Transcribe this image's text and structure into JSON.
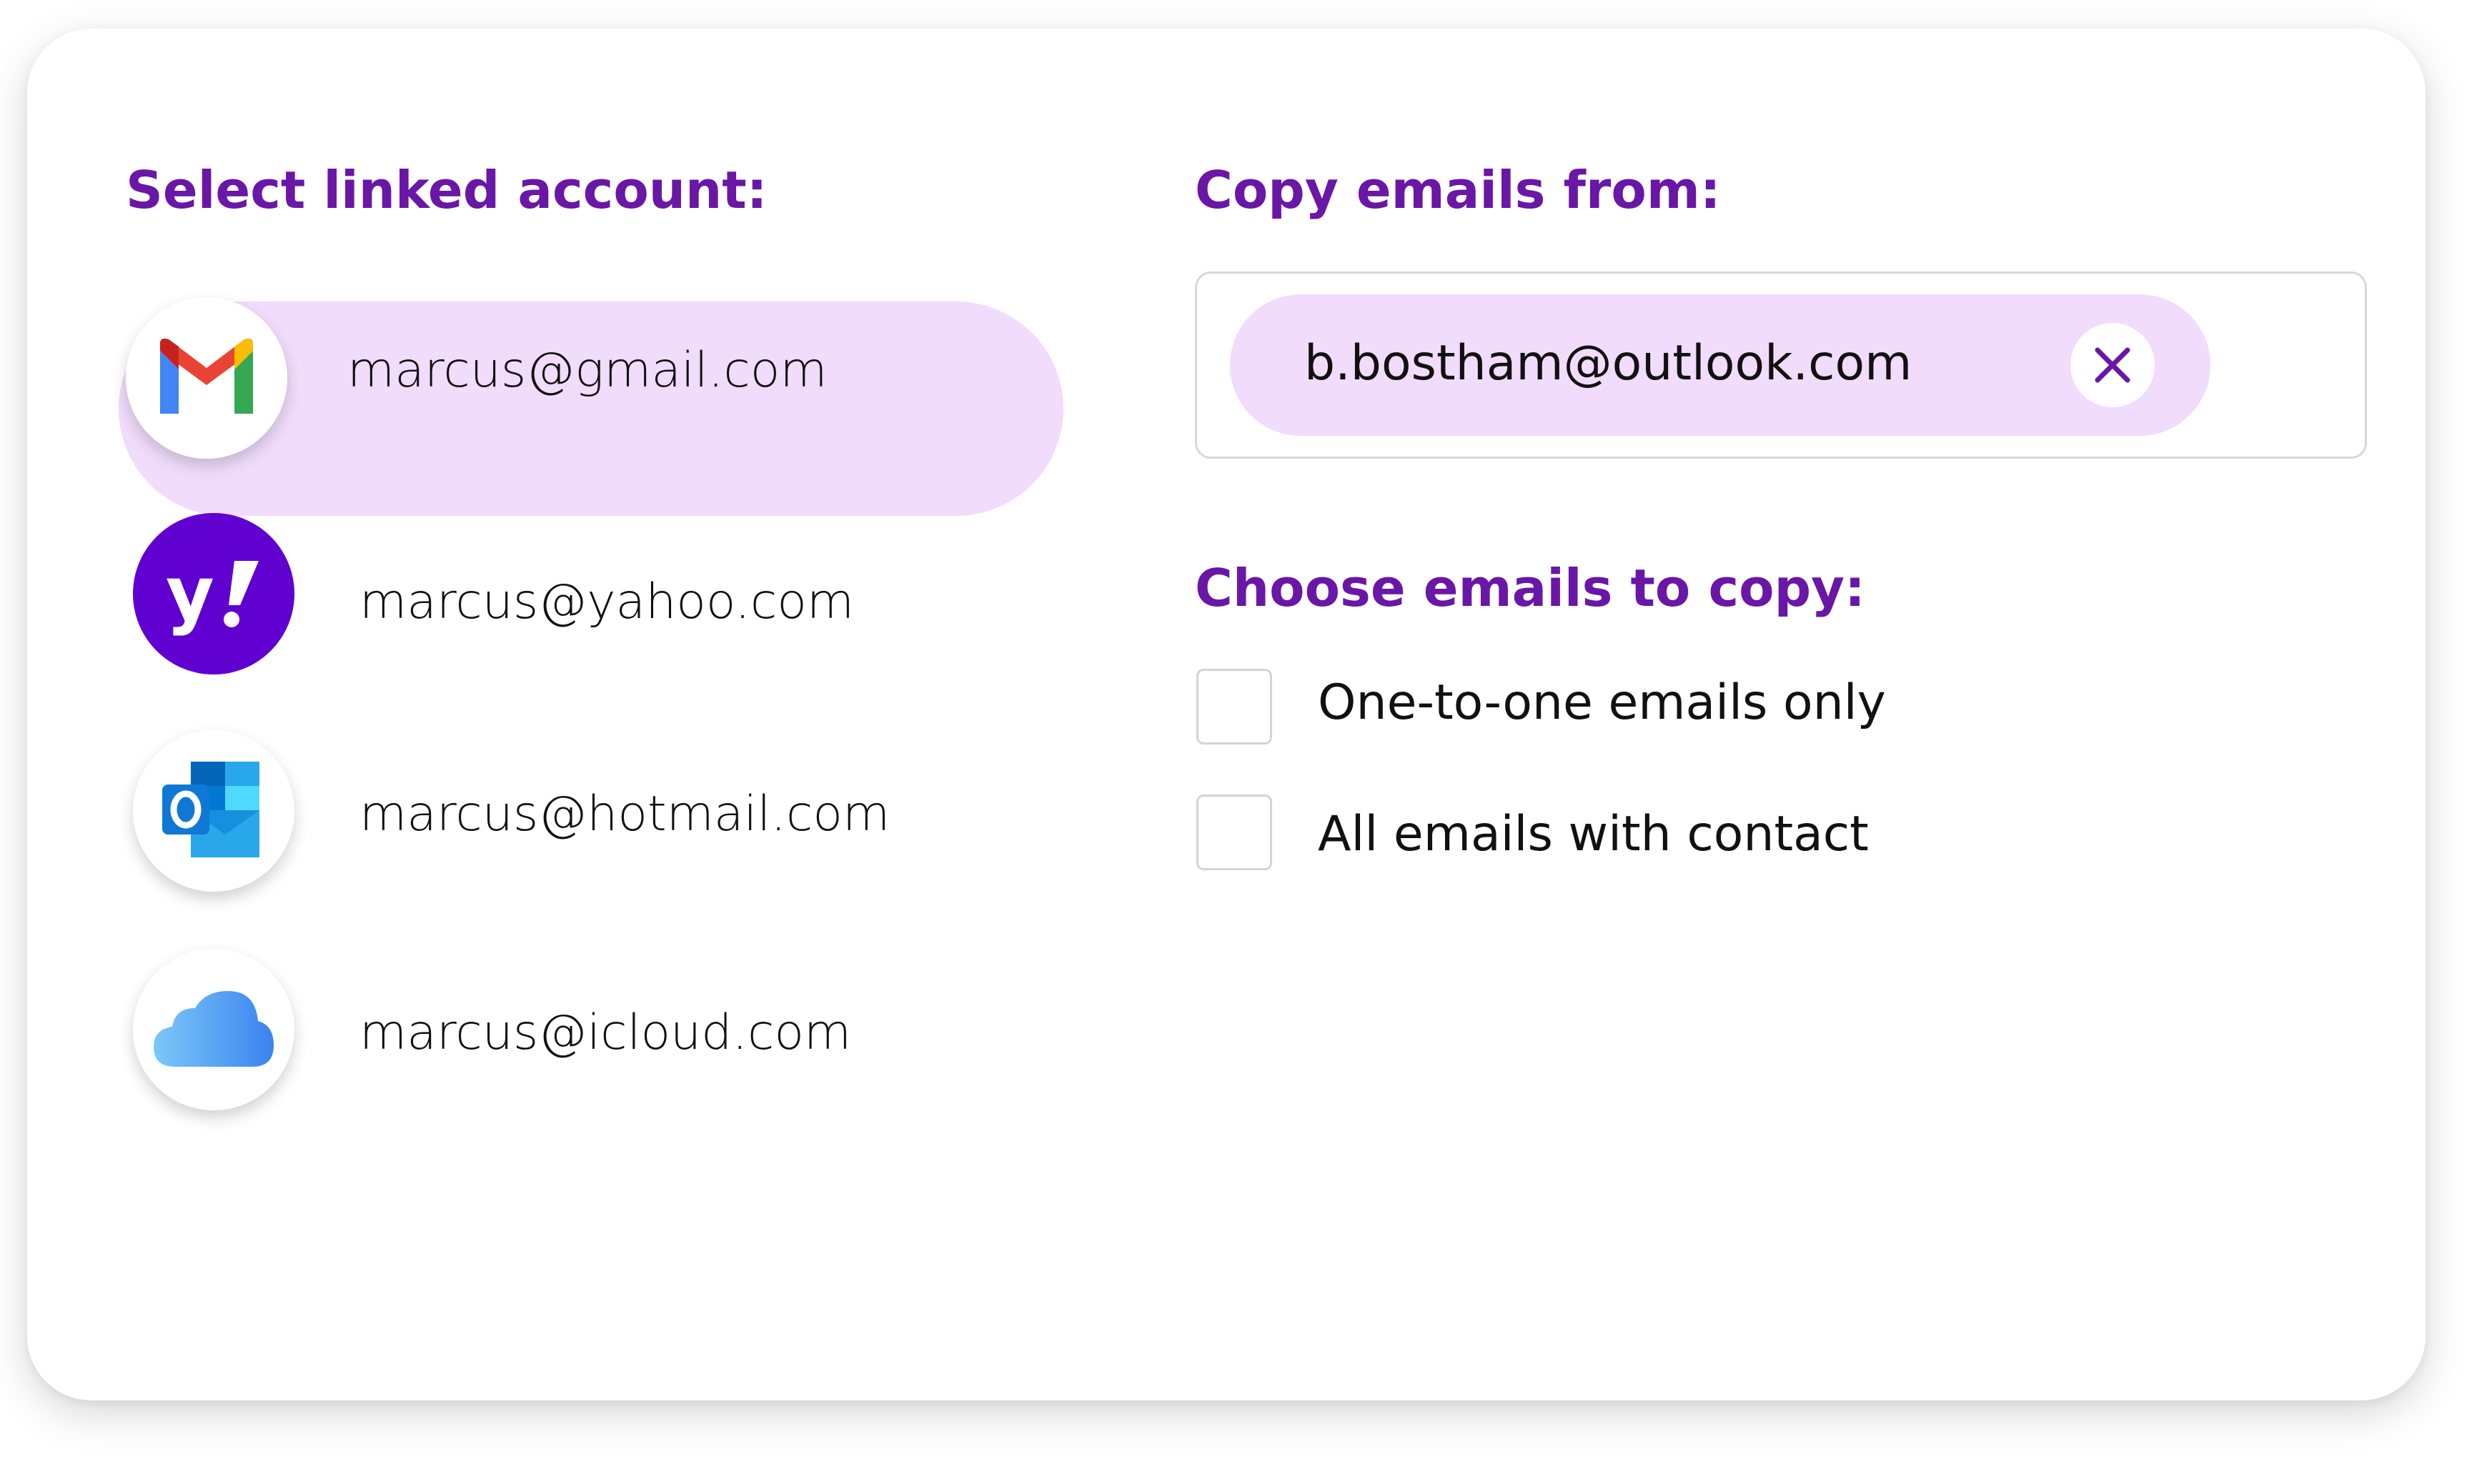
{
  "left_panel": {
    "heading": "Select linked account:",
    "accounts": [
      {
        "email": "marcus@gmail.com",
        "provider_icon": "gmail-icon",
        "selected": true
      },
      {
        "email": "marcus@yahoo.com",
        "provider_icon": "yahoo-icon",
        "selected": false
      },
      {
        "email": "marcus@hotmail.com",
        "provider_icon": "outlook-icon",
        "selected": false
      },
      {
        "email": "marcus@icloud.com",
        "provider_icon": "icloud-icon",
        "selected": false
      }
    ]
  },
  "right_panel": {
    "copy_heading": "Copy emails from:",
    "copy_from_chip": "b.bostham@outlook.com",
    "choose_heading": "Choose emails to copy:",
    "options": [
      {
        "label": "One-to-one emails only",
        "checked": false
      },
      {
        "label": "All emails with contact",
        "checked": false
      }
    ]
  },
  "colors": {
    "accent": "#6a16a6",
    "selection_bg": "#f1dcfc",
    "yahoo": "#6001d2"
  }
}
